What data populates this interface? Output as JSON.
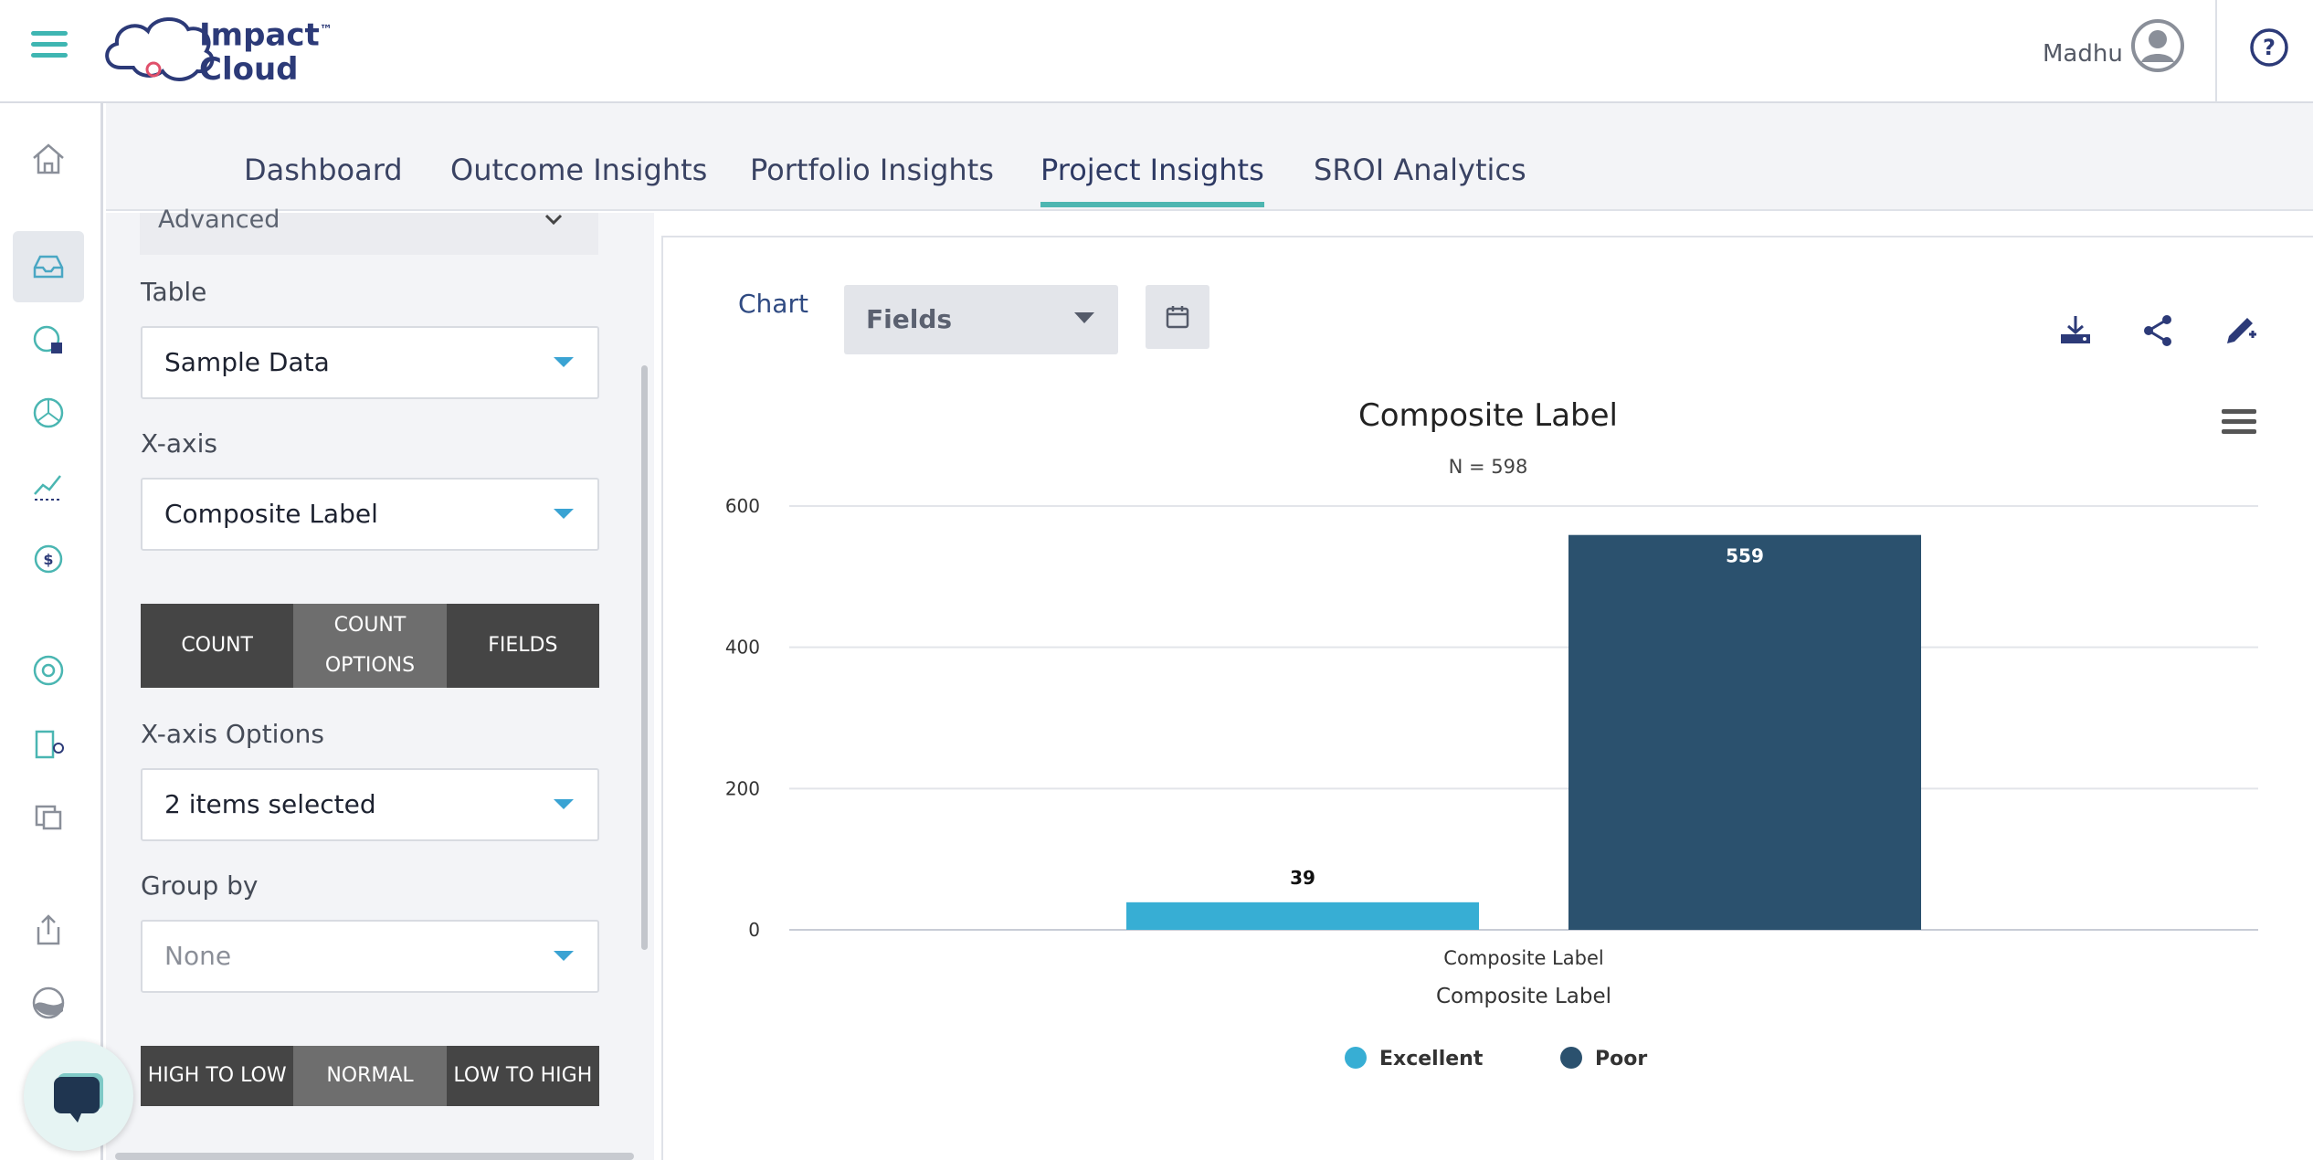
{
  "brand": {
    "line1": "Impact",
    "line2": "Cloud",
    "tm": "™"
  },
  "user": {
    "name": "Madhu"
  },
  "tabs": [
    {
      "label": "Dashboard"
    },
    {
      "label": "Outcome Insights"
    },
    {
      "label": "Portfolio Insights"
    },
    {
      "label": "Project Insights",
      "active": true
    },
    {
      "label": "SROI Analytics"
    }
  ],
  "panel": {
    "advanced": "Advanced",
    "table_label": "Table",
    "table_value": "Sample Data",
    "xaxis_label": "X-axis",
    "xaxis_value": "Composite Label",
    "agg_buttons": {
      "count": "COUNT",
      "count_options_1": "COUNT",
      "count_options_2": "OPTIONS",
      "fields": "FIELDS"
    },
    "xaxis_options_label": "X-axis Options",
    "xaxis_options_value": "2 items selected",
    "group_by_label": "Group by",
    "group_by_value": "None",
    "sort_buttons": {
      "high_to_low": "HIGH TO LOW",
      "normal": "NORMAL",
      "low_to_high": "LOW TO HIGH"
    }
  },
  "toolbar": {
    "chart_label": "Chart",
    "fields_value": "Fields"
  },
  "colors": {
    "accent": "#4db6b1",
    "excellent": "#37aed4",
    "poor": "#2b516e"
  },
  "chart_data": {
    "type": "bar",
    "title": "Composite Label",
    "subtitle": "N = 598",
    "categories": [
      "Composite Label"
    ],
    "xlabel": "Composite Label",
    "ylabel": "",
    "ylim": [
      0,
      600
    ],
    "yticks": [
      0,
      200,
      400,
      600
    ],
    "grid": true,
    "legend": "bottom-center",
    "series": [
      {
        "name": "Excellent",
        "values": [
          39
        ],
        "color": "#37aed4"
      },
      {
        "name": "Poor",
        "values": [
          559
        ],
        "color": "#2b516e"
      }
    ]
  }
}
